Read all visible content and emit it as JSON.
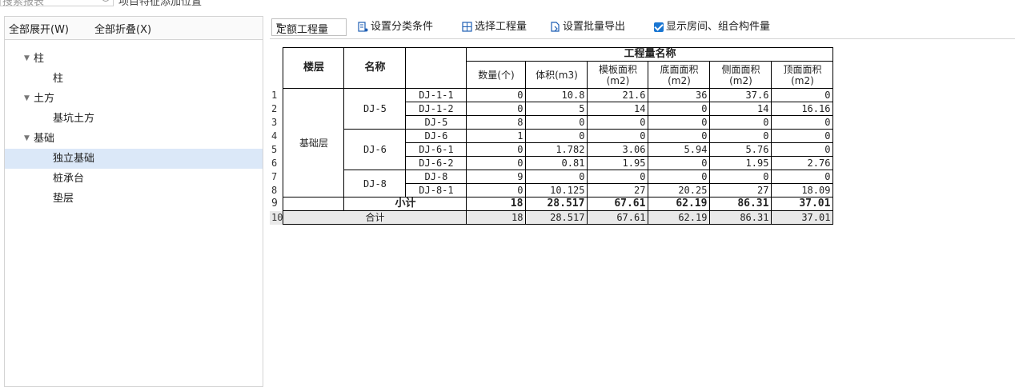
{
  "search": {
    "placeholder": "搜索报表",
    "hint": "项目特征添加位置"
  },
  "left": {
    "expand_all": "全部展开(W)",
    "collapse_all": "全部折叠(X)",
    "tree": [
      {
        "label": "柱",
        "level": 0
      },
      {
        "label": "柱",
        "level": 1
      },
      {
        "label": "土方",
        "level": 0
      },
      {
        "label": "基坑土方",
        "level": 1
      },
      {
        "label": "基础",
        "level": 0
      },
      {
        "label": "独立基础",
        "level": 1,
        "selected": true
      },
      {
        "label": "桩承台",
        "level": 1
      },
      {
        "label": "垫层",
        "level": 1
      }
    ]
  },
  "toolbar": {
    "quantity_type": "定额工程量",
    "set_category": "设置分类条件",
    "select_quantity": "选择工程量",
    "batch_export": "设置批量导出",
    "show_rooms": "显示房间、组合构件量",
    "show_rooms_checked": true
  },
  "table": {
    "group_header": "工程量名称",
    "col_floor": "楼层",
    "col_name": "名称",
    "col_qty": "数量(个)",
    "col_volume": "体积(m3)",
    "col_formwork": "模板面积(m2)",
    "col_bottom": "底面面积(m2)",
    "col_side": "侧面面积(m2)",
    "col_top": "顶面面积(m2)",
    "floor": "基础层",
    "groups": [
      "DJ-5",
      "DJ-6",
      "DJ-8"
    ],
    "rows": [
      {
        "n": "1",
        "item": "DJ-1-1",
        "v": [
          "0",
          "10.8",
          "21.6",
          "36",
          "37.6",
          "0"
        ]
      },
      {
        "n": "2",
        "item": "DJ-1-2",
        "v": [
          "0",
          "5",
          "14",
          "0",
          "14",
          "16.16"
        ]
      },
      {
        "n": "3",
        "item": "DJ-5",
        "v": [
          "8",
          "0",
          "0",
          "0",
          "0",
          "0"
        ]
      },
      {
        "n": "4",
        "item": "DJ-6",
        "v": [
          "1",
          "0",
          "0",
          "0",
          "0",
          "0"
        ]
      },
      {
        "n": "5",
        "item": "DJ-6-1",
        "v": [
          "0",
          "1.782",
          "3.06",
          "5.94",
          "5.76",
          "0"
        ]
      },
      {
        "n": "6",
        "item": "DJ-6-2",
        "v": [
          "0",
          "0.81",
          "1.95",
          "0",
          "1.95",
          "2.76"
        ]
      },
      {
        "n": "7",
        "item": "DJ-8",
        "v": [
          "9",
          "0",
          "0",
          "0",
          "0",
          "0"
        ]
      },
      {
        "n": "8",
        "item": "DJ-8-1",
        "v": [
          "0",
          "10.125",
          "27",
          "20.25",
          "27",
          "18.09"
        ]
      }
    ],
    "subtotal": {
      "n": "9",
      "label": "小计",
      "v": [
        "18",
        "28.517",
        "67.61",
        "62.19",
        "86.31",
        "37.01"
      ]
    },
    "total": {
      "n": "10",
      "label": "合计",
      "v": [
        "18",
        "28.517",
        "67.61",
        "62.19",
        "86.31",
        "37.01"
      ]
    }
  }
}
